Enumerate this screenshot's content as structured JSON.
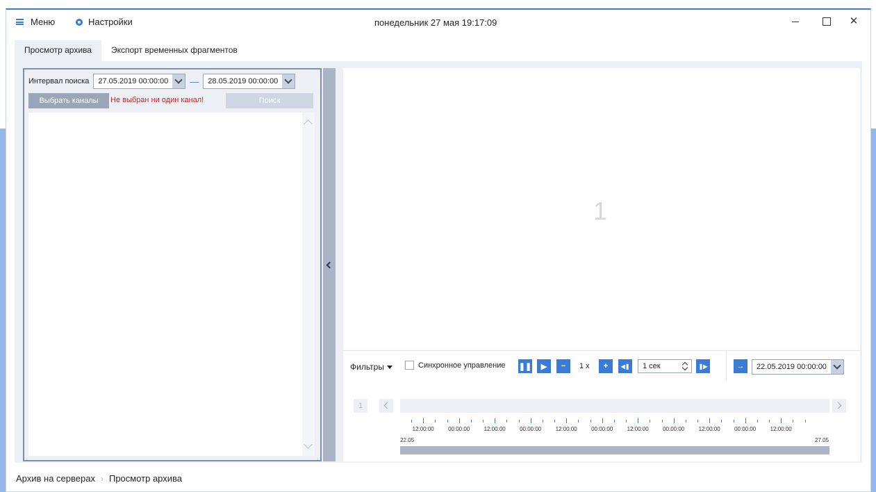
{
  "titlebar": {
    "menu_label": "Меню",
    "settings_label": "Настройки",
    "datetime": "понедельник 27 мая 19:17:09",
    "minimize": "",
    "maximize": "",
    "close": "✕"
  },
  "tabs": [
    {
      "label": "Просмотр архива",
      "active": true
    },
    {
      "label": "Экспорт временных фрагментов",
      "active": false
    }
  ],
  "search_panel": {
    "interval_label": "Интервал поиска",
    "date_from": "27.05.2019  00:00:00",
    "dash": "—",
    "date_to": "28.05.2019  00:00:00",
    "select_channels_label": "Выбрать каналы",
    "no_channel_warning": "Не выбран ни один канал!",
    "search_label": "Поиск"
  },
  "viewer": {
    "cell_number": "1"
  },
  "controls": {
    "filters_label": "Фильтры",
    "sync_label": "Синхронное управление",
    "speed": "1 x",
    "step": "1 сек",
    "goto_date": "22.05.2019  00:00:00",
    "minus": "−",
    "plus": "+"
  },
  "timeline": {
    "page_number": "1",
    "tick_labels": [
      "12:00:00",
      "00:00:00",
      "12:00:00",
      "00:00:00",
      "12:00:00",
      "00:00:00",
      "12:00:00",
      "00:00:00",
      "12:00:00",
      "00:00:00",
      "12:00:00"
    ],
    "start_date": "22.05",
    "end_date": "27.05"
  },
  "breadcrumb": {
    "items": [
      "Архив на серверах",
      "Просмотр архива"
    ],
    "separator": "›"
  },
  "colors": {
    "accent": "#3a7bd5",
    "warning": "#e01e1e",
    "panel_bg": "#eceff4"
  }
}
